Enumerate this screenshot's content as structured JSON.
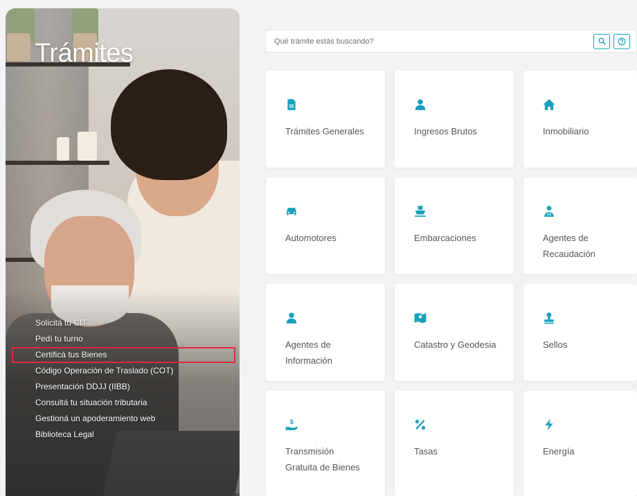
{
  "hero": {
    "title": "Trámites",
    "quick_links": [
      "Solicitá tu CIT",
      "Pedí tu turno",
      "Certificá tus Bienes",
      "Código Operación de Traslado (COT)",
      "Presentación DDJJ (IIBB)",
      "Consultá tu situación tributaria",
      "Gestioná un apoderamiento web",
      "Biblioteca Legal"
    ]
  },
  "search": {
    "placeholder": "Qué trámite estás buscando?",
    "search_icon": "search-icon",
    "help_icon": "help-circle-icon"
  },
  "accent_color": "#18a1bd",
  "highlight_color": "#e0283c",
  "cards": [
    {
      "label": "Trámites Generales",
      "icon": "document-icon"
    },
    {
      "label": "Ingresos Brutos",
      "icon": "user-icon"
    },
    {
      "label": "Inmobiliario",
      "icon": "house-icon"
    },
    {
      "label": "Automotores",
      "icon": "car-icon"
    },
    {
      "label": "Embarcaciones",
      "icon": "ship-icon"
    },
    {
      "label": "Agentes de Recaudación",
      "icon": "agent-icon"
    },
    {
      "label": "Agentes de Información",
      "icon": "user-icon"
    },
    {
      "label": "Catastro y Geodesia",
      "icon": "map-icon"
    },
    {
      "label": "Sellos",
      "icon": "stamp-icon"
    },
    {
      "label": "Transmisión Gratuita de Bienes",
      "icon": "hand-money-icon"
    },
    {
      "label": "Tasas",
      "icon": "percent-icon"
    },
    {
      "label": "Energía",
      "icon": "bolt-icon"
    }
  ]
}
